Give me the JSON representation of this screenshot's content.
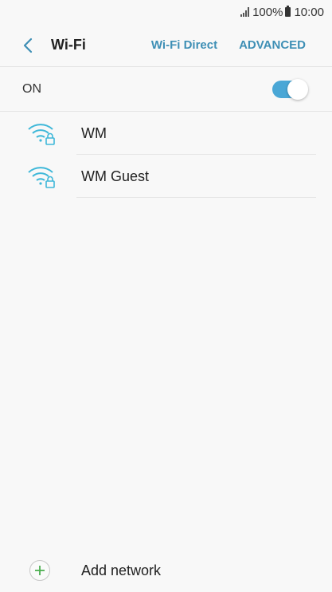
{
  "status_bar": {
    "battery": "100%",
    "time": "10:00"
  },
  "app_bar": {
    "title": "Wi-Fi",
    "wifi_direct_label": "Wi-Fi Direct",
    "advanced_label": "ADVANCED"
  },
  "wifi_toggle": {
    "label": "ON",
    "state": "on"
  },
  "networks": [
    {
      "name": "WM",
      "secured": true
    },
    {
      "name": "WM Guest",
      "secured": true
    }
  ],
  "add_network_label": "Add network",
  "colors": {
    "accent": "#3e8fb5",
    "switch_on": "#4aa7d6",
    "wifi_icon": "#3fb8d9",
    "add_plus": "#4caf50",
    "background": "#f8f8f8"
  },
  "icons": [
    "back-arrow-icon",
    "signal-icon",
    "battery-icon",
    "wifi-lock-icon",
    "plus-icon"
  ]
}
